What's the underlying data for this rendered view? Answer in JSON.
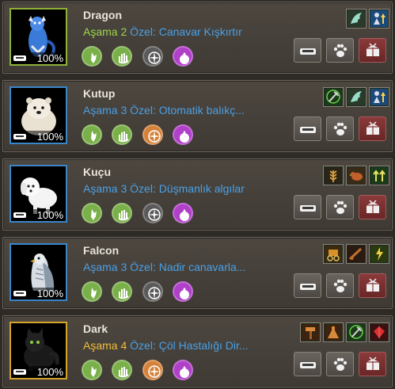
{
  "pets": [
    {
      "name": "Dragon",
      "stage_label": "Aşama",
      "stage_num": "2",
      "stage_color": "green",
      "special": "Özel: Canavar Kışkırtır",
      "food": "100%",
      "frame": "green",
      "skills": [
        "#7ab04a",
        "#7ab04a",
        "#5a5a5a",
        "#b040c8"
      ],
      "buffs": [
        "wing-icon",
        "person-up-icon"
      ],
      "portrait": "blue-dragon"
    },
    {
      "name": "Kutup",
      "stage_label": "Aşama",
      "stage_num": "3",
      "stage_color": "blue",
      "special": "Özel: Otomatik balıkç...",
      "food": "100%",
      "frame": "blue",
      "skills": [
        "#7ab04a",
        "#7ab04a",
        "#d4823a",
        "#b040c8"
      ],
      "buffs": [
        "pickaxe-icon",
        "wing-icon",
        "person-up-icon"
      ],
      "portrait": "polar-bear"
    },
    {
      "name": "Kuçu",
      "stage_label": "Aşama",
      "stage_num": "3",
      "stage_color": "blue",
      "special": "Özel: Düşmanlık algılar",
      "food": "100%",
      "frame": "blue",
      "skills": [
        "#7ab04a",
        "#7ab04a",
        "#5a5a5a",
        "#b040c8"
      ],
      "buffs": [
        "wheat-icon",
        "bird-icon",
        "arrows-up-icon"
      ],
      "portrait": "white-dog"
    },
    {
      "name": "Falcon",
      "stage_label": "Aşama",
      "stage_num": "3",
      "stage_color": "blue",
      "special": "Özel: Nadir canavarla...",
      "food": "100%",
      "frame": "blue",
      "skills": [
        "#7ab04a",
        "#7ab04a",
        "#5a5a5a",
        "#b040c8"
      ],
      "buffs": [
        "carriage-icon",
        "rifle-icon",
        "lightning-person-icon"
      ],
      "portrait": "falcon"
    },
    {
      "name": "Dark",
      "stage_label": "Aşama",
      "stage_num": "4",
      "stage_color": "gold",
      "special": "Özel: Çöl Hastalığı Dir...",
      "food": "100%",
      "frame": "gold",
      "skills": [
        "#7ab04a",
        "#7ab04a",
        "#d4823a",
        "#b040c8"
      ],
      "buffs": [
        "hammer-icon",
        "flask-icon",
        "pickaxe-icon",
        "red-gem-icon"
      ],
      "portrait": "dark-cat"
    }
  ],
  "actions": [
    "feed-button",
    "pet-button",
    "release-button"
  ]
}
